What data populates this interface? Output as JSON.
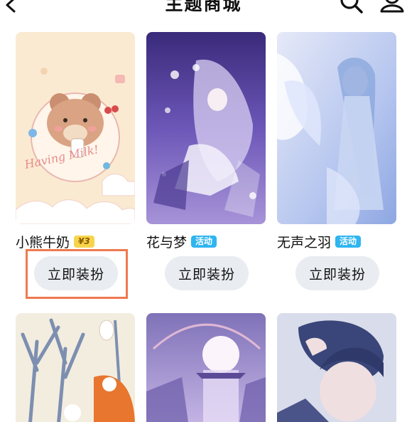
{
  "header": {
    "title": "主题商城",
    "back_icon": "chevron-left-icon",
    "search_icon": "search-icon",
    "profile_icon": "person-icon"
  },
  "themes": [
    {
      "name": "小熊牛奶",
      "badge": "¥3",
      "badge_type": "price",
      "button": "立即装扮",
      "artwork_text": "Having Milk!"
    },
    {
      "name": "花与梦",
      "badge": "活动",
      "badge_type": "event",
      "button": "立即装扮"
    },
    {
      "name": "无声之羽",
      "badge": "活动",
      "badge_type": "event",
      "button": "立即装扮"
    },
    {},
    {},
    {}
  ],
  "colors": {
    "price_badge": "#f7d44c",
    "event_badge": "#2fb5f0",
    "button_bg": "#e9ecf1",
    "highlight": "#ef7a4f"
  }
}
